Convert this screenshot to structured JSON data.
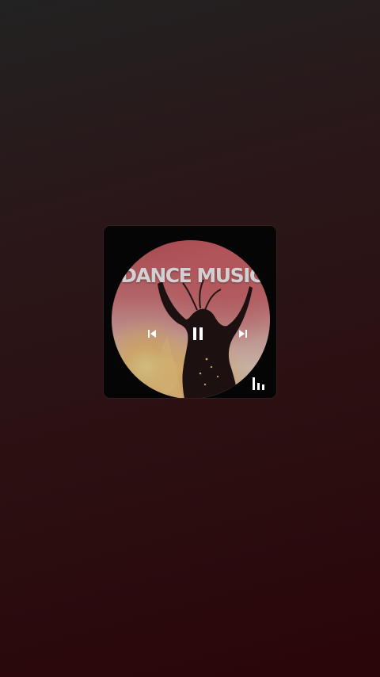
{
  "widget": {
    "album_art_text": "DANCE MUSIC",
    "icons": {
      "previous": "skip-previous-icon",
      "pause": "pause-icon",
      "next": "skip-next-icon",
      "equalizer": "equalizer-icon"
    }
  },
  "colors": {
    "background_top": "#222222",
    "background_bottom": "#2a0509",
    "widget_background": "#050505",
    "icon_color": "#ffffff"
  }
}
